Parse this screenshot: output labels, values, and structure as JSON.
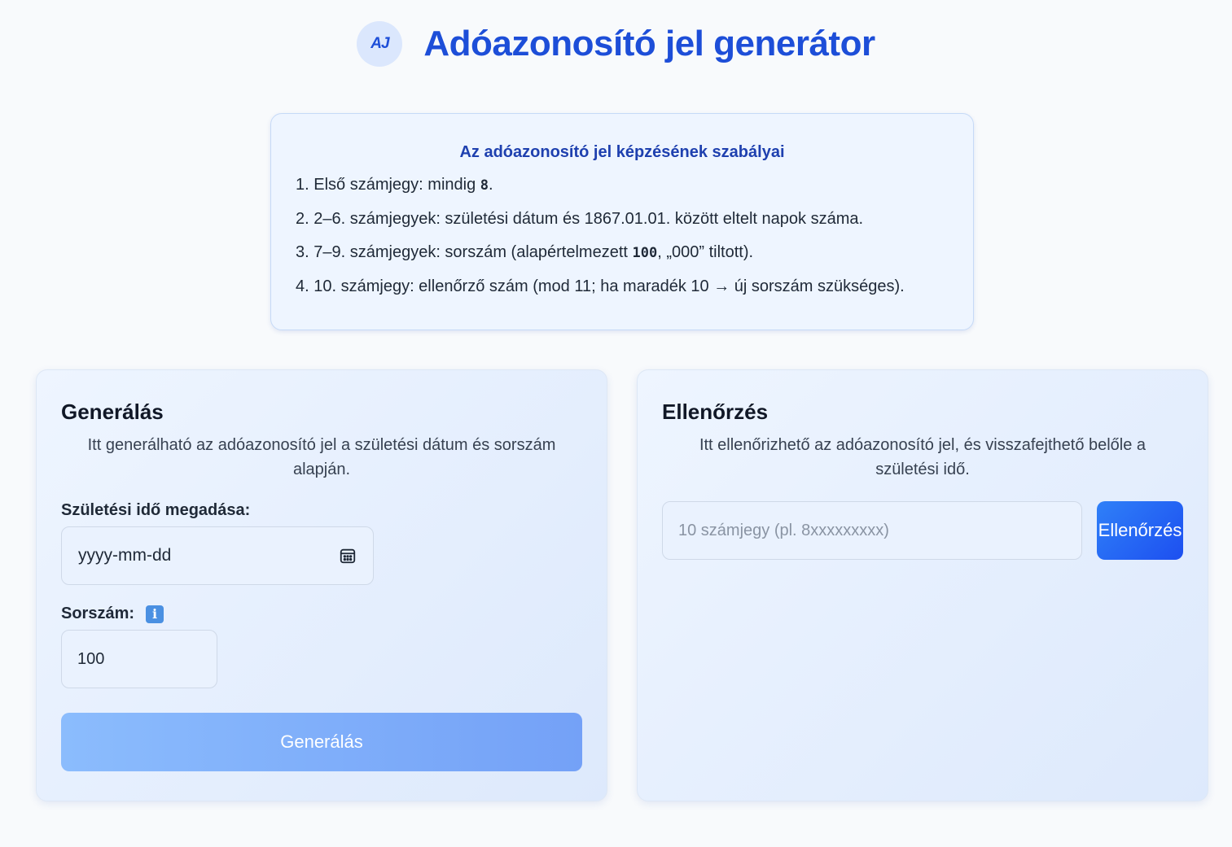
{
  "header": {
    "logo_text": "AJ",
    "title": "Adóazonosító jel generátor"
  },
  "rules": {
    "title": "Az adóazonosító jel képzésének szabályai",
    "items": [
      {
        "prefix": "1. Első számjegy: mindig ",
        "code": "8",
        "suffix": "."
      },
      {
        "prefix": "2. 2–6. számjegyek: születési dátum és 1867.01.01. között eltelt napok száma.",
        "code": "",
        "suffix": ""
      },
      {
        "prefix": "3. 7–9. számjegyek: sorszám (alapértelmezett ",
        "code": "100",
        "suffix": ", „000” tiltott)."
      },
      {
        "prefix": "4. 10. számjegy: ellenőrző szám (mod 11; ha maradék 10 → új sorszám szükséges).",
        "code": "",
        "suffix": ""
      }
    ]
  },
  "generate": {
    "title": "Generálás",
    "description": "Itt generálható az adóazonosító jel a születési dátum és sorszám alapján.",
    "birth_label": "Születési idő megadása:",
    "birth_placeholder": "yyyy-mm-dd",
    "serial_label": "Sorszám:",
    "serial_info_icon": "i",
    "serial_value": "100",
    "button_label": "Generálás"
  },
  "verify": {
    "title": "Ellenőrzés",
    "description": "Itt ellenőrizhető az adóazonosító jel, és visszafejthető belőle a születési idő.",
    "input_placeholder": "10 számjegy (pl. 8xxxxxxxxx)",
    "button_label": "Ellenőrzés"
  },
  "colors": {
    "accent": "#1d4ed8",
    "background": "#f8fafc",
    "generate_button": "#8bbcfd",
    "verify_button": "#2563eb"
  }
}
